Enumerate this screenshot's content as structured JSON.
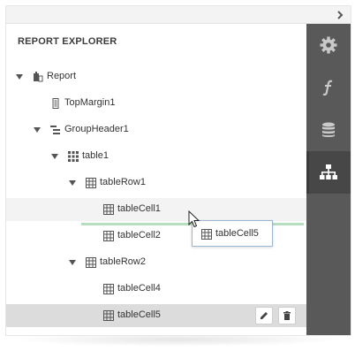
{
  "panel": {
    "title": "REPORT EXPLORER",
    "collapse_icon": "chevron-right-icon"
  },
  "tree": [
    {
      "label": "Report",
      "icon": "report-icon",
      "expanded": true
    },
    {
      "label": "TopMargin1",
      "icon": "margin-band-icon"
    },
    {
      "label": "GroupHeader1",
      "icon": "group-header-icon",
      "expanded": true
    },
    {
      "label": "table1",
      "icon": "table-icon",
      "expanded": true
    },
    {
      "label": "tableRow1",
      "icon": "table-row-icon",
      "expanded": true
    },
    {
      "label": "tableCell1",
      "icon": "table-cell-icon",
      "state": "hover"
    },
    {
      "label": "tableCell2",
      "icon": "table-cell-icon"
    },
    {
      "label": "tableRow2",
      "icon": "table-row-icon",
      "expanded": true
    },
    {
      "label": "tableCell4",
      "icon": "table-cell-icon"
    },
    {
      "label": "tableCell5",
      "icon": "table-cell-icon",
      "state": "selected"
    }
  ],
  "row_actions": {
    "edit_icon": "pencil-icon",
    "delete_icon": "trash-icon"
  },
  "drag": {
    "label": "tableCell5",
    "icon": "table-cell-icon"
  },
  "sidebar": {
    "tabs": [
      {
        "icon": "gear-icon",
        "active": false
      },
      {
        "icon": "function-icon",
        "active": false
      },
      {
        "icon": "database-icon",
        "active": false
      },
      {
        "icon": "hierarchy-icon",
        "active": true
      }
    ]
  },
  "colors": {
    "sidebar_bg": "#595959",
    "sidebar_active": "#474747",
    "selected_row": "#dcdcdc",
    "drop_indicator": "#b5dfbf",
    "drag_border": "#9bb7d4"
  }
}
